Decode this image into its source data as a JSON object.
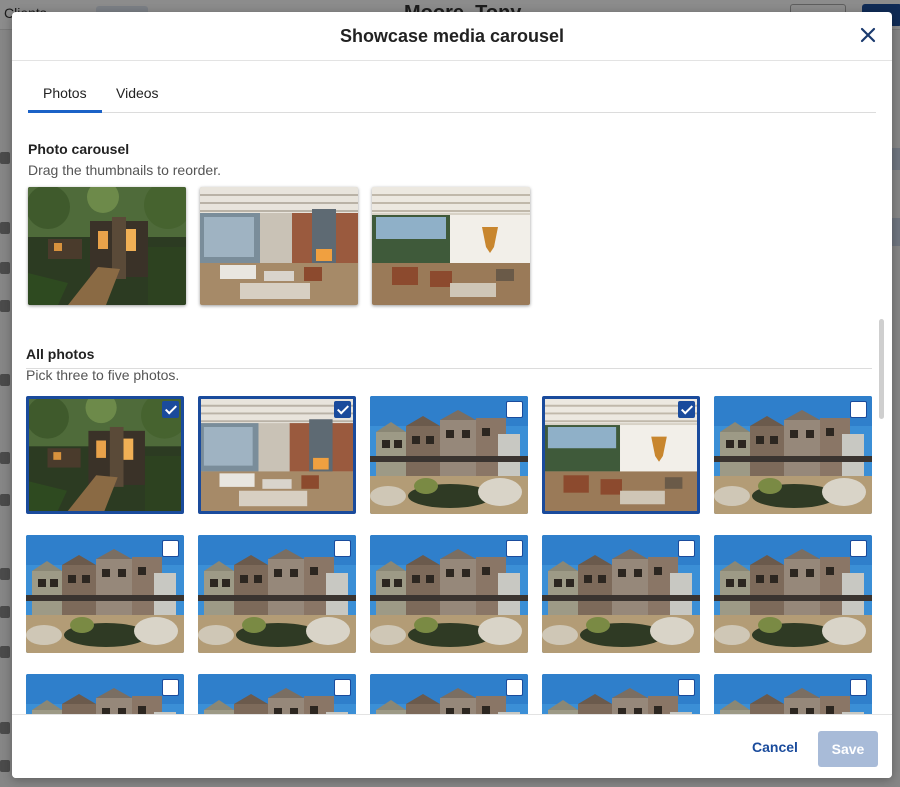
{
  "background": {
    "back_label": "Clients",
    "title": "Moore, Tony"
  },
  "modal": {
    "title": "Showcase media carousel",
    "tabs": [
      {
        "label": "Photos",
        "active": true
      },
      {
        "label": "Videos",
        "active": false
      }
    ],
    "carousel": {
      "title": "Photo carousel",
      "hint": "Drag the thumbnails to reorder."
    },
    "all_photos": {
      "title": "All photos",
      "hint": "Pick three to five photos."
    },
    "footer": {
      "cancel_label": "Cancel",
      "save_label": "Save"
    }
  },
  "colors": {
    "accent": "#1a4b9c",
    "tab_underline": "#1b62c7",
    "save_disabled": "#a8bbd8"
  },
  "photos": [
    {
      "scene": "exterior-forest",
      "selected": true
    },
    {
      "scene": "living-fireplace",
      "selected": true
    },
    {
      "scene": "townhouses",
      "selected": false
    },
    {
      "scene": "living-window",
      "selected": true
    },
    {
      "scene": "townhouses",
      "selected": false
    },
    {
      "scene": "townhouses",
      "selected": false
    },
    {
      "scene": "townhouses",
      "selected": false
    },
    {
      "scene": "townhouses",
      "selected": false
    },
    {
      "scene": "townhouses",
      "selected": false
    },
    {
      "scene": "townhouses",
      "selected": false
    },
    {
      "scene": "townhouses",
      "selected": false
    },
    {
      "scene": "townhouses",
      "selected": false
    },
    {
      "scene": "townhouses",
      "selected": false
    },
    {
      "scene": "townhouses",
      "selected": false
    },
    {
      "scene": "townhouses",
      "selected": false
    }
  ],
  "carousel_photos": [
    "exterior-forest",
    "living-fireplace",
    "living-window"
  ]
}
